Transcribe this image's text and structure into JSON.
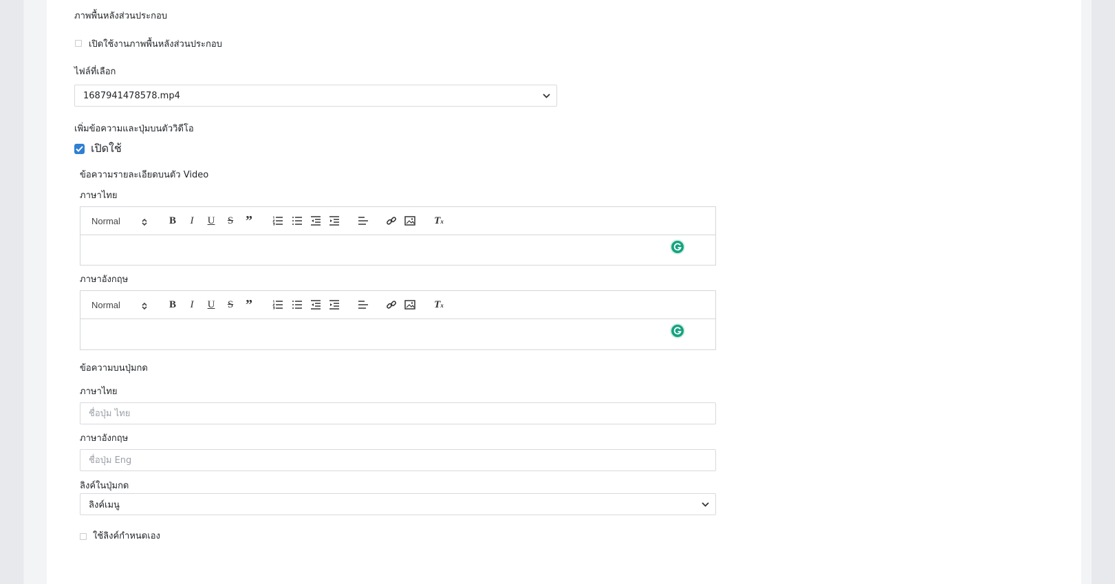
{
  "section_bg": {
    "title": "ภาพพื้นหลังส่วนประกอบ",
    "enable_label": "เปิดใช้งานภาพพื้นหลังส่วนประกอบ",
    "file_label": "ไฟล์ที่เลือก",
    "file_value": "1687941478578.mp4"
  },
  "section_overlay": {
    "title": "เพิ่มข้อความและปุ่มบนตัววิดีโอ",
    "enable_label": "เปิดใช้",
    "detail_title": "ข้อความรายละเอียดบนตัว Video",
    "thai_label": "ภาษาไทย",
    "eng_label": "ภาษาอังกฤษ",
    "toolbar_format": "Normal",
    "button_title": "ข้อความบนปุ่มกด",
    "button_thai_label": "ภาษาไทย",
    "button_thai_placeholder": "ชื่อปุ่ม ไทย",
    "button_eng_label": "ภาษาอังกฤษ",
    "button_eng_placeholder": "ชื่อปุ่ม Eng",
    "link_label": "ลิงค์ในปุ่มกด",
    "link_value": "ลิงค์เมนู",
    "custom_link_label": "ใช้ลิงค์กำหนดเอง"
  },
  "colors": {
    "accent": "#2f7fd3",
    "grammarly": "#15a37f"
  }
}
